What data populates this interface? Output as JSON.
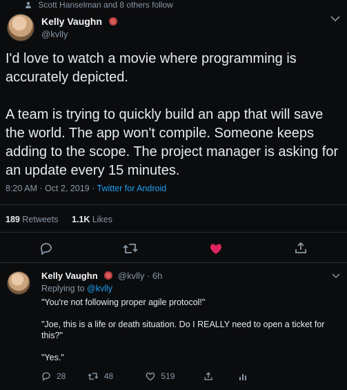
{
  "social_context": {
    "text": "Scott Hanselman and 8 others follow"
  },
  "main_tweet": {
    "author_name": "Kelly Vaughn",
    "handle": "@kvlly",
    "paragraph1": "I'd love to watch a movie where programming is accurately depicted.",
    "paragraph2": "A team is trying to quickly build an app that will save the world. The app won't compile. Someone keeps adding to the scope. The project manager is asking for an update every 15 minutes.",
    "timestamp": "8:20 AM · Oct 2, 2019 ·",
    "source": "Twitter for Android",
    "stats": {
      "retweets_count": "189",
      "retweets_label": "Retweets",
      "likes_count": "1.1K",
      "likes_label": "Likes"
    },
    "actions": {
      "reply_icon": "reply-icon",
      "retweet_icon": "retweet-icon",
      "like_icon": "heart-icon",
      "like_color": "#e0245e",
      "share_icon": "share-icon"
    }
  },
  "reply_tweet": {
    "author_name": "Kelly Vaughn",
    "handle_time": "@kvlly · 6h",
    "replying_to_label": "Replying to",
    "replying_to_handle": "@kvlly",
    "line1": "\"You're not following proper agile protocol!\"",
    "line2": "\"Joe, this is a life or death situation. Do I REALLY need to open a ticket for this?\"",
    "line3": "\"Yes.\"",
    "counts": {
      "replies": "28",
      "retweets": "48",
      "likes": "519"
    }
  },
  "colors": {
    "background": "#0b0c0e",
    "text": "#e8ebee",
    "muted": "#8899a6",
    "link": "#1da1f2",
    "like": "#e0245e"
  }
}
